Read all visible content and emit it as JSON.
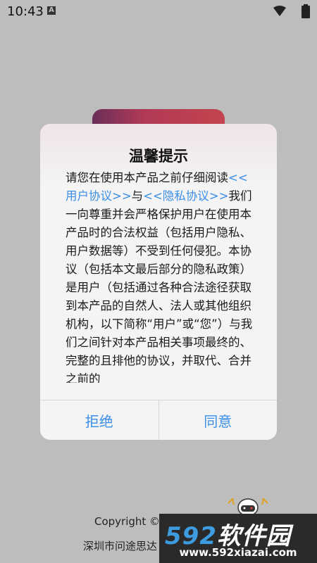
{
  "status_bar": {
    "time": "10:43",
    "notification_icon": "A"
  },
  "background": {
    "copyright": "Copyright ©",
    "company": "深圳市问途思达"
  },
  "dialog": {
    "title": "温馨提示",
    "body": {
      "intro": "请您在使用本产品之前仔细阅读",
      "link_user_agreement": "<<用户协议>>",
      "conjunction": "与",
      "link_privacy_policy": "<<隐私协议>>",
      "content": "我们一向尊重并会严格保护用户在使用本产品时的合法权益（包括用户隐私、用户数据等）不受到任何侵犯。本协议（包括本文最后部分的隐私政策）是用户（包括通过各种合法途径获取到本产品的自然人、法人或其他组织机构，以下简称“用户”或“您”）与我们之间针对本产品相关事项最终的、完整的且排他的协议，并取代、合并之前的"
    },
    "reject_label": "拒绝",
    "agree_label": "同意"
  },
  "watermark": {
    "number": "592",
    "text": "软件园",
    "url": "www.592xiazai.com"
  },
  "colors": {
    "accent": "#3b8ee8"
  }
}
